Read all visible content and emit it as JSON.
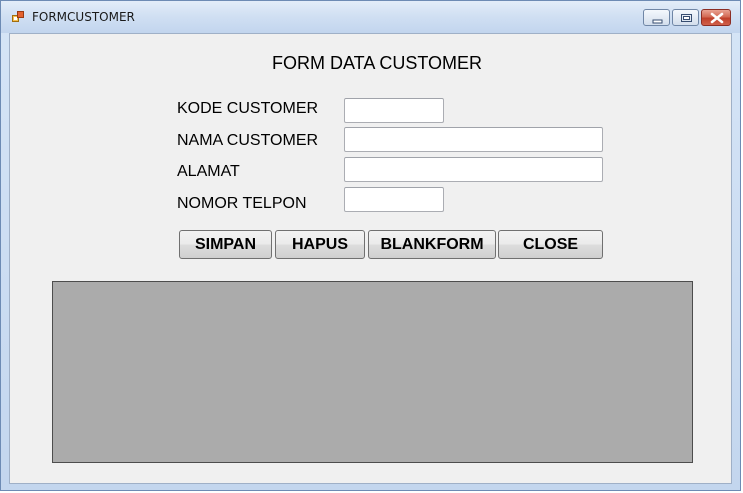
{
  "window": {
    "title": "FORMCUSTOMER",
    "controls": [
      "minimize-icon",
      "maximize-icon",
      "close-icon"
    ]
  },
  "form": {
    "title": "FORM DATA CUSTOMER",
    "fields": {
      "kode": {
        "label": "KODE CUSTOMER",
        "value": ""
      },
      "nama": {
        "label": "NAMA CUSTOMER",
        "value": ""
      },
      "alamat": {
        "label": "ALAMAT",
        "value": ""
      },
      "telpon": {
        "label": "NOMOR TELPON",
        "value": ""
      }
    },
    "buttons": {
      "simpan": "SIMPAN",
      "hapus": "HAPUS",
      "blankform": "BLANKFORM",
      "close": "CLOSE"
    }
  },
  "colors": {
    "form_background": "#f0f0f0",
    "grid_background": "#ababab",
    "close_button": "#c0402b"
  }
}
